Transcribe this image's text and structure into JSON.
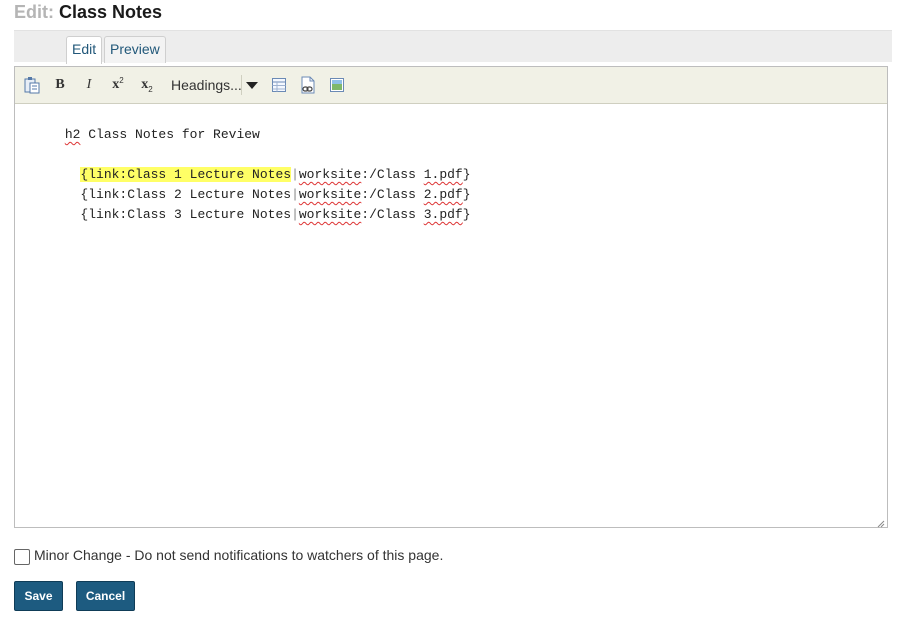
{
  "header": {
    "prefix": "Edit:",
    "title": "Class Notes"
  },
  "tabs": [
    {
      "label": "Edit",
      "active": true
    },
    {
      "label": "Preview",
      "active": false
    }
  ],
  "toolbar": {
    "bold": "B",
    "italic": "I",
    "superscript": {
      "base": "x",
      "mark": "2"
    },
    "subscript": {
      "base": "x",
      "mark": "2"
    },
    "headings": "Headings...",
    "icons": [
      "paste-icon",
      "table-icon",
      "link-icon",
      "image-icon"
    ]
  },
  "editor": {
    "lines": [
      {
        "t1": "h2",
        "t2": " Class Notes for Review"
      },
      {
        "a": "{link:Class 1 Lecture Notes",
        "b": "|",
        "c": "worksite",
        "d": ":/Class ",
        "e": "1.pdf",
        "f": "}"
      },
      {
        "a": "{link:Class 2 Lecture Notes",
        "b": "|",
        "c": "worksite",
        "d": ":/Class ",
        "e": "2.pdf",
        "f": "}"
      },
      {
        "a": "{link:Class 3 Lecture Notes",
        "b": "|",
        "c": "worksite",
        "d": ":/Class ",
        "e": "3.pdf",
        "f": "}"
      }
    ],
    "highlight_color": "#ffff66"
  },
  "minor_change": {
    "label": "Minor Change - Do not send notifications to watchers of this page.",
    "checked": false
  },
  "buttons": {
    "save": "Save",
    "cancel": "Cancel"
  },
  "colors": {
    "button": "#1d5b80",
    "toolbar": "#f1f1e6",
    "tab_text": "#22587a"
  }
}
